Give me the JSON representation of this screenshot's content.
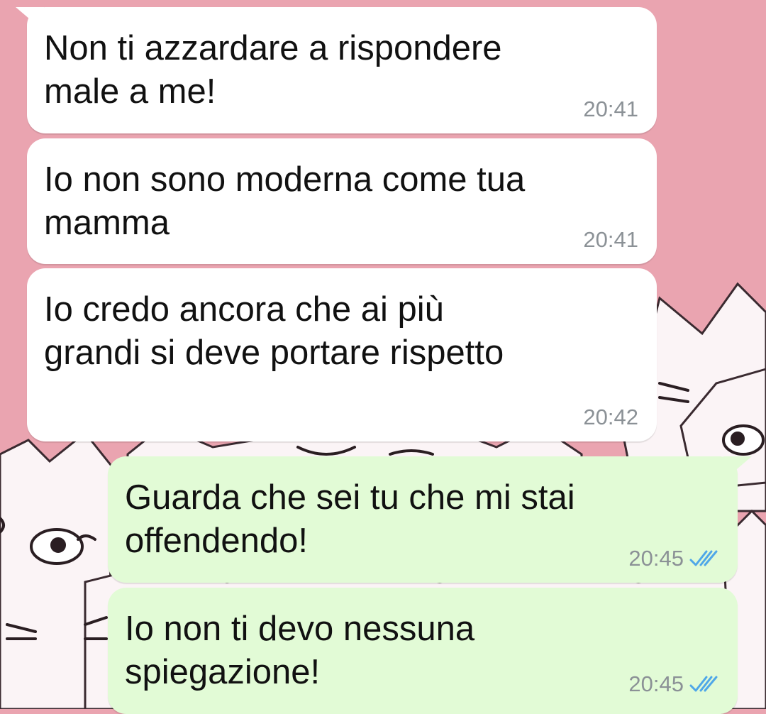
{
  "chat": {
    "theme": {
      "wallpaper_color": "#eaa4b0",
      "incoming_bubble_color": "#ffffff",
      "outgoing_bubble_color": "#e2fbd6",
      "read_tick_color": "#4fa7e8"
    },
    "messages": [
      {
        "direction": "incoming",
        "text": "Non ti azzardare a rispondere\nmale a me!",
        "time": "20:41"
      },
      {
        "direction": "incoming",
        "text": "Io non sono moderna come tua\nmamma",
        "time": "20:41"
      },
      {
        "direction": "incoming",
        "text": "Io credo ancora che ai più\ngrandi si deve portare rispetto",
        "time": "20:42"
      },
      {
        "direction": "outgoing",
        "text": "Guarda che sei tu che mi stai\noffendendo!",
        "time": "20:45",
        "status_icon": "double-check-read-icon"
      },
      {
        "direction": "outgoing",
        "text": "Io non ti devo nessuna\nspiegazione!",
        "time": "20:45",
        "status_icon": "double-check-read-icon"
      }
    ]
  }
}
